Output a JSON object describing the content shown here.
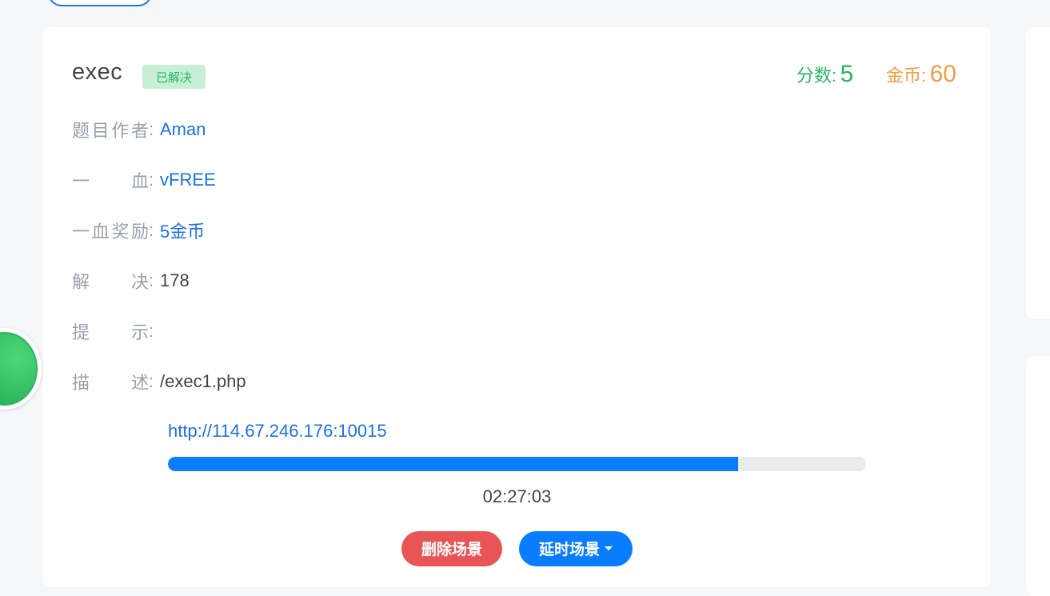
{
  "challenge": {
    "title": "exec",
    "status_badge": "已解决",
    "score_label": "分数:",
    "score_value": "5",
    "coins_label": "金币:",
    "coins_value": "60"
  },
  "details": [
    {
      "label_chars": [
        "题",
        "目",
        "作",
        "者"
      ],
      "value": "Aman",
      "link": true
    },
    {
      "label_chars": [
        "一",
        "血"
      ],
      "value": "vFREE",
      "link": true
    },
    {
      "label_chars": [
        "一",
        "血",
        "奖",
        "励"
      ],
      "value": "5金币",
      "link": true
    },
    {
      "label_chars": [
        "解",
        "决"
      ],
      "value": "178",
      "link": false
    },
    {
      "label_chars": [
        "提",
        "示"
      ],
      "value": "",
      "link": false
    },
    {
      "label_chars": [
        "描",
        "述"
      ],
      "value": "/exec1.php",
      "link": false
    }
  ],
  "colon": ":",
  "scene": {
    "url": "http://114.67.246.176:10015",
    "progress_fraction": 0.817,
    "timer": "02:27:03",
    "delete_button": "删除场景",
    "extend_button": "延时场景"
  },
  "colors": {
    "accent": "#1a73e8",
    "success": "#2bb463",
    "coins": "#f59b42",
    "danger": "#e85555"
  }
}
